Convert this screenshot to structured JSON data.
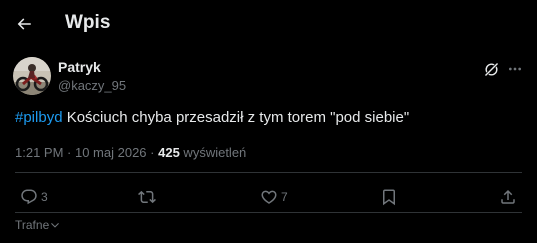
{
  "header": {
    "title": "Wpis",
    "back_icon": "arrow-left-icon"
  },
  "author": {
    "display_name": "Patryk",
    "handle": "@kaczy_95",
    "avatar": "avatar-motorcycle-rider"
  },
  "post": {
    "hashtag": "#pilbyd",
    "text": " Kościuch chyba przesadził z tym torem \"pod siebie\"",
    "time": "1:21 PM",
    "separator_1": " · ",
    "date": "10 maj 2026",
    "separator_2": " · ",
    "views_count": "425",
    "views_label": " wyświetleń"
  },
  "actions": {
    "reply_count": "3",
    "retweet_count": "",
    "like_count": "7",
    "reply_icon": "reply-icon",
    "retweet_icon": "retweet-icon",
    "like_icon": "heart-icon",
    "bookmark_icon": "bookmark-icon",
    "share_icon": "share-icon"
  },
  "sort": {
    "label": "Trafne",
    "icon": "chevron-down-icon"
  },
  "colors": {
    "background": "#000000",
    "text_primary": "#e7e9ea",
    "text_secondary": "#71767b",
    "accent": "#1d9bf0",
    "border": "#2f3336"
  }
}
